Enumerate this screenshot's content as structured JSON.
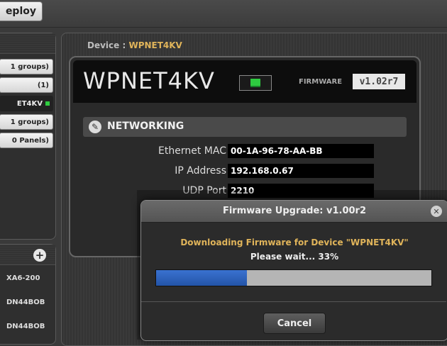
{
  "toolbar": {
    "deploy_label": "eploy"
  },
  "left_panel": {
    "items": [
      {
        "label": "1 groups)",
        "style": "light"
      },
      {
        "label": "(1)",
        "style": "light"
      },
      {
        "label": "ET4KV",
        "style": "dark",
        "status": "online"
      },
      {
        "label": "1 groups)",
        "style": "light"
      },
      {
        "label": "0 Panels)",
        "style": "light"
      }
    ]
  },
  "left_panel2": {
    "items": [
      "XA6-200",
      "DN44BOB",
      "DN44BOB"
    ]
  },
  "device": {
    "label": "Device :",
    "name": "WPNET4KV",
    "big_name": "WPNET4KV",
    "firmware_label": "FIRMWARE",
    "firmware_value": "v1.02r7",
    "section_title": "NETWORKING",
    "fields": [
      {
        "label": "Ethernet MAC",
        "value": "00-1A-96-78-AA-BB"
      },
      {
        "label": "IP Address",
        "value": "192.168.0.67"
      },
      {
        "label": "UDP Port",
        "value": "2210"
      }
    ]
  },
  "modal": {
    "title": "Firmware Upgrade: v1.00r2",
    "message": "Downloading Firmware for Device \"WPNET4KV\"",
    "status": "Please wait... 33%",
    "progress": 0.33,
    "cancel_label": "Cancel"
  },
  "colors": {
    "accent": "#e0b45a",
    "progress": "#2f64c0",
    "online": "#2ecc40"
  }
}
